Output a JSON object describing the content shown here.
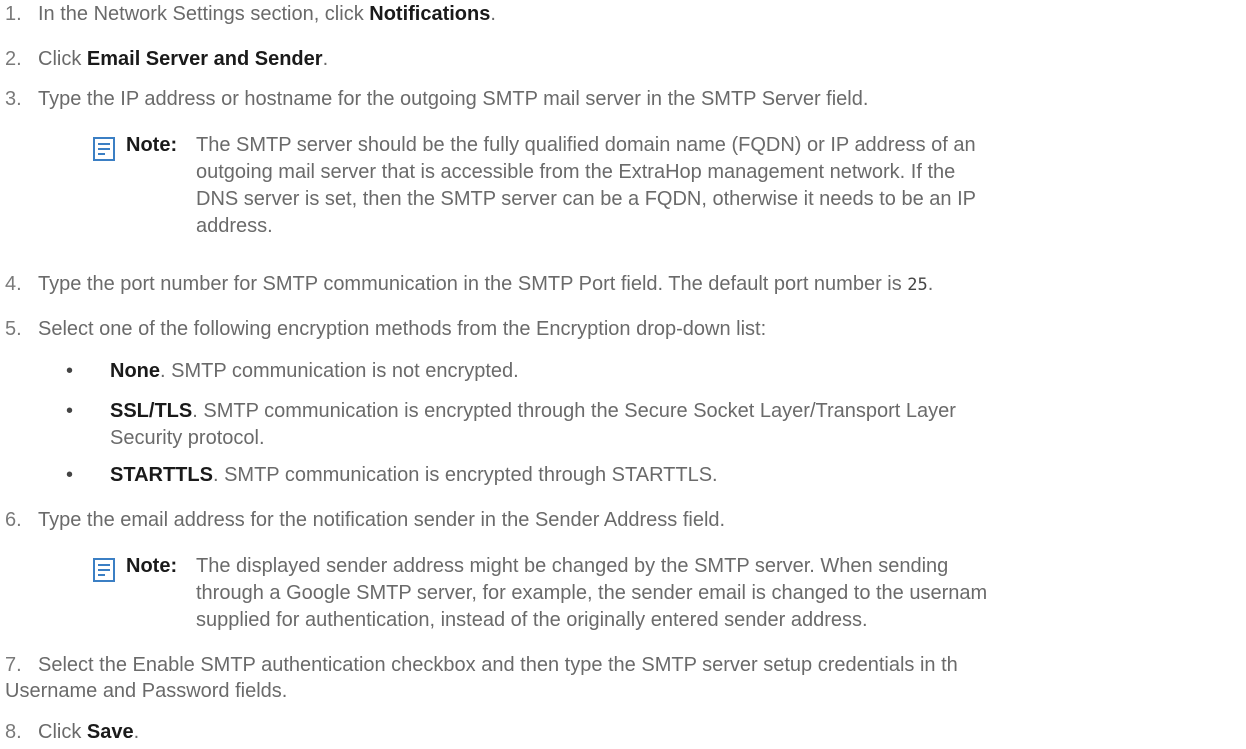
{
  "steps": [
    {
      "num": "1.",
      "pre": "In the Network Settings section, click ",
      "bold": "Notifications",
      "post": "."
    },
    {
      "num": "2.",
      "pre": "Click ",
      "bold": "Email Server and Sender",
      "post": "."
    },
    {
      "num": "3.",
      "text": "Type the IP address or hostname for the outgoing SMTP mail server in the SMTP Server field."
    },
    {
      "num": "4.",
      "pre": "Type the port number for SMTP communication in the SMTP Port field. The default port number is ",
      "code": "25",
      "post": "."
    },
    {
      "num": "5.",
      "text": "Select one of the following encryption methods from the Encryption drop-down list:"
    },
    {
      "num": "6.",
      "text": "Type the email address for the notification sender in the Sender Address field."
    },
    {
      "num": "7.",
      "text": "Select the Enable SMTP authentication checkbox and then type the SMTP server setup credentials in th",
      "text2": "Username and Password fields."
    },
    {
      "num": "8.",
      "pre": "Click ",
      "bold": "Save",
      "post": "."
    }
  ],
  "notes": [
    {
      "label": "Note:",
      "lines": [
        "The SMTP server should be the fully qualified domain name (FQDN) or IP address of an",
        "outgoing mail server that is accessible from the ExtraHop management network. If the",
        "DNS server is set, then the SMTP server can be a FQDN, otherwise it needs to be an IP",
        "address."
      ]
    },
    {
      "label": "Note:",
      "lines": [
        "The displayed sender address might be changed by the SMTP server. When sending",
        "through a Google SMTP server, for example, the sender email is changed to the usernam",
        "supplied for authentication, instead of the originally entered sender address."
      ]
    }
  ],
  "encryption_options": [
    {
      "bullet": "•",
      "bold": "None",
      "text": ". SMTP communication is not encrypted."
    },
    {
      "bullet": "•",
      "bold": "SSL/TLS",
      "text": ". SMTP communication is encrypted through the Secure Socket Layer/Transport Layer",
      "text2": "Security protocol."
    },
    {
      "bullet": "•",
      "bold": "STARTTLS",
      "text": ". SMTP communication is encrypted through STARTTLS."
    }
  ],
  "note_icon": "note-icon",
  "colors": {
    "text": "#6a6a6a",
    "bold": "#1a1a1a",
    "icon": "#3b7fc4"
  }
}
